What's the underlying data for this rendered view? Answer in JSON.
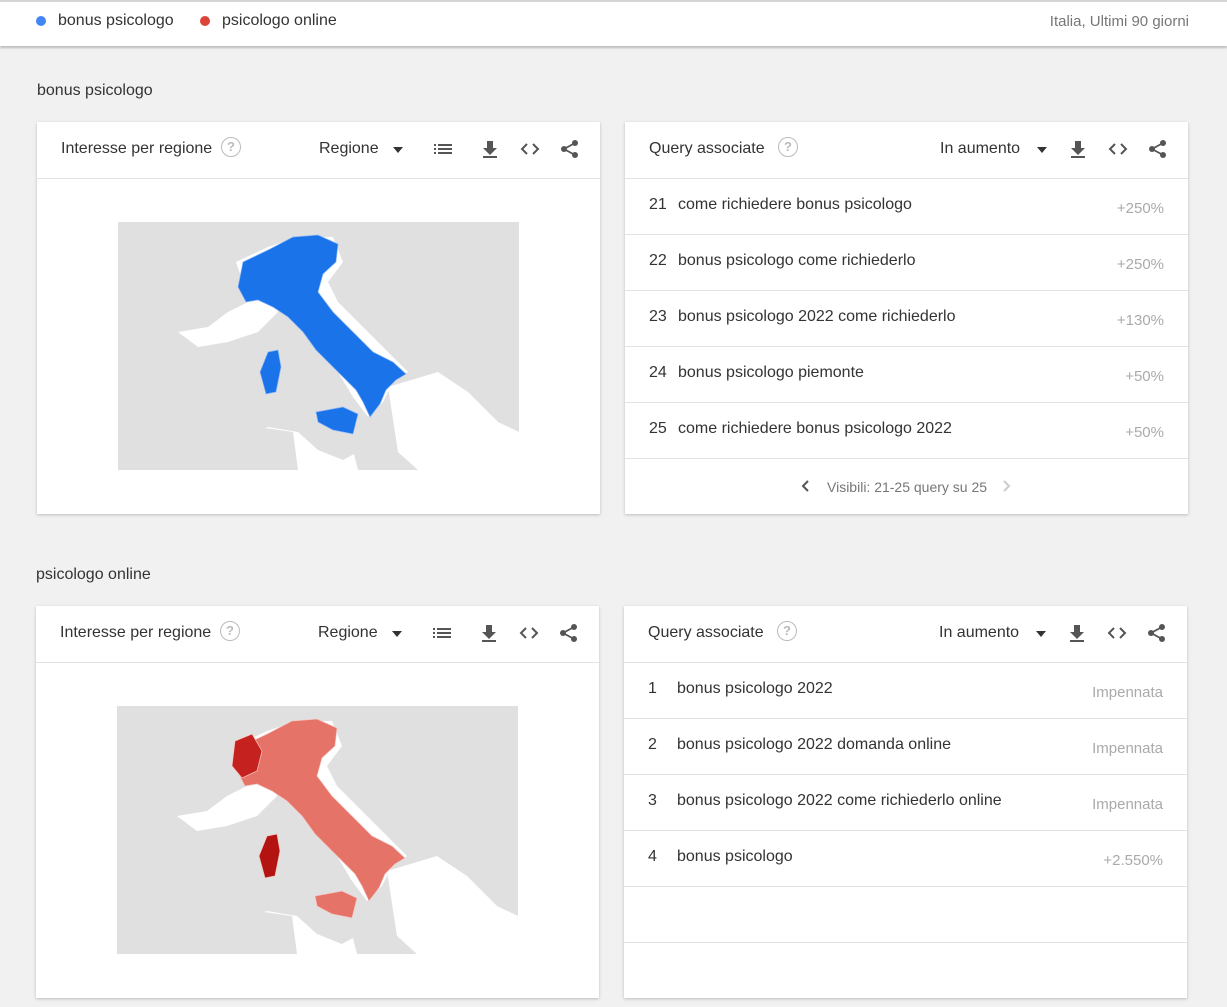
{
  "header": {
    "legend": [
      {
        "label": "bonus psicologo",
        "color": "#4285f4"
      },
      {
        "label": "psicologo online",
        "color": "#db4437"
      }
    ],
    "scope": "Italia, Ultimi 90 giorni"
  },
  "sections": [
    {
      "title": "bonus psicologo",
      "region_card": {
        "title": "Interesse per regione",
        "help_icon": "help-circle-icon",
        "dropdown": "Regione",
        "icons": [
          "list-icon",
          "download-icon",
          "embed-code-icon",
          "share-icon"
        ]
      },
      "query_card": {
        "title": "Query associate",
        "help_icon": "help-circle-icon",
        "dropdown": "In aumento",
        "icons": [
          "download-icon",
          "embed-code-icon",
          "share-icon"
        ],
        "rows": [
          {
            "rank": "21",
            "query": "come richiedere bonus psicologo",
            "value": "+250%"
          },
          {
            "rank": "22",
            "query": "bonus psicologo come richiederlo",
            "value": "+250%"
          },
          {
            "rank": "23",
            "query": "bonus psicologo 2022 come richiederlo",
            "value": "+130%"
          },
          {
            "rank": "24",
            "query": "bonus psicologo piemonte",
            "value": "+50%"
          },
          {
            "rank": "25",
            "query": "come richiedere bonus psicologo 2022",
            "value": "+50%"
          }
        ],
        "pager": "Visibili: 21-25 query su 25"
      },
      "map_color": "#1a73e8"
    },
    {
      "title": "psicologo online",
      "region_card": {
        "title": "Interesse per regione",
        "help_icon": "help-circle-icon",
        "dropdown": "Regione",
        "icons": [
          "list-icon",
          "download-icon",
          "embed-code-icon",
          "share-icon"
        ]
      },
      "query_card": {
        "title": "Query associate",
        "help_icon": "help-circle-icon",
        "dropdown": "In aumento",
        "icons": [
          "download-icon",
          "embed-code-icon",
          "share-icon"
        ],
        "rows": [
          {
            "rank": "1",
            "query": "bonus psicologo 2022",
            "value": "Impennata"
          },
          {
            "rank": "2",
            "query": "bonus psicologo 2022 domanda online",
            "value": "Impennata"
          },
          {
            "rank": "3",
            "query": "bonus psicologo 2022 come richiederlo online",
            "value": "Impennata"
          },
          {
            "rank": "4",
            "query": "bonus psicologo",
            "value": "+2.550%"
          }
        ]
      },
      "map_color": "#c5221f"
    }
  ]
}
